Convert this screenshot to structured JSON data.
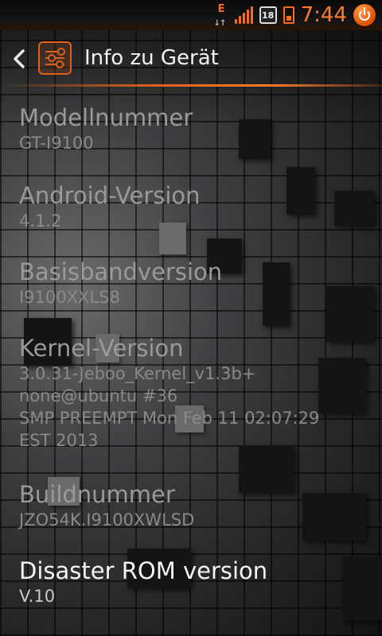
{
  "statusbar": {
    "network_type": "E",
    "calendar_day": "18",
    "time": "7:44"
  },
  "actionbar": {
    "title": "Info zu Gerät"
  },
  "items": [
    {
      "label": "Modellnummer",
      "value": "GT-I9100"
    },
    {
      "label": "Android-Version",
      "value": "4.1.2"
    },
    {
      "label": "Basisbandversion",
      "value": "I9100XXLS8"
    },
    {
      "label": "Kernel-Version",
      "value_lines": [
        "3.0.31-Jeboo_Kernel_v1.3b+",
        "none@ubuntu #36",
        "SMP PREEMPT Mon Feb 11 02:07:29",
        "EST 2013"
      ]
    },
    {
      "label": "Buildnummer",
      "value": "JZO54K.I9100XWLSD"
    },
    {
      "label": "Disaster ROM version",
      "value": "V.10"
    }
  ],
  "colors": {
    "accent": "#e0601a",
    "clock": "#ff7a2a"
  }
}
